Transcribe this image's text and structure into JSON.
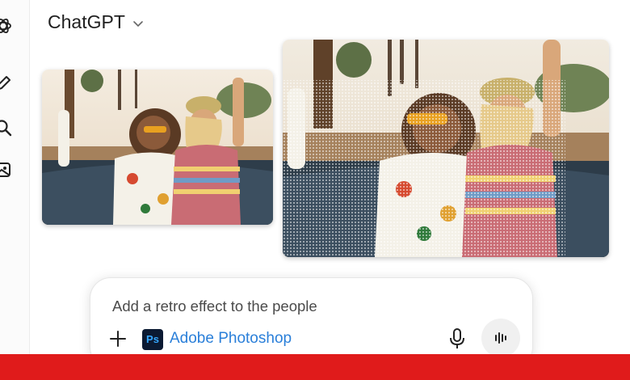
{
  "header": {
    "model_name": "ChatGPT"
  },
  "sidebar": {
    "icons": [
      "openai-logo-icon",
      "new-chat-icon",
      "search-icon",
      "library-icon"
    ]
  },
  "images": [
    {
      "name": "original-photo",
      "alt": "Two women smiling in a convertible car"
    },
    {
      "name": "edited-photo",
      "alt": "Same photo with a retro halftone effect on the people"
    }
  ],
  "composer": {
    "prompt_text": "Add a retro effect to the people",
    "tool_badge": "Ps",
    "tool_label": "Adobe Photoshop"
  },
  "colors": {
    "accent_link": "#2a7fd9",
    "footer_bar": "#e01b1b"
  }
}
